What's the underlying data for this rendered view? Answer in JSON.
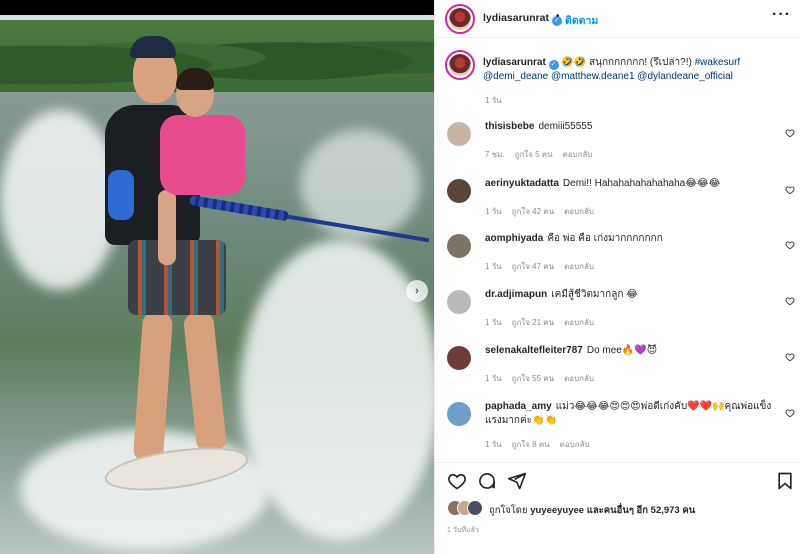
{
  "header": {
    "username": "lydiasarunrat",
    "follow_label": "ติดตาม",
    "dot": "•",
    "more_label": "···"
  },
  "caption": {
    "username": "lydiasarunrat",
    "text": "🤣🤣 สนุกกกกกกก! (รึเปล่า?!)",
    "hashtag": "#wakesurf",
    "mentions": "@demi_deane @matthew.deane1 @dylandeane_official",
    "time": "1 วัน"
  },
  "comments": [
    {
      "username": "thisisbebe",
      "text": "demiii55555",
      "time": "7 ชม.",
      "likes": "ถูกใจ 5 คน",
      "reply": "ตอบกลับ",
      "avatar_color": "#c9b3a5"
    },
    {
      "username": "aerinyuktadatta",
      "text": "Demi!! Hahahahahahahaha😂😂😂",
      "time": "1 วัน",
      "likes": "ถูกใจ 42 คน",
      "reply": "ตอบกลับ",
      "avatar_color": "#5a4636"
    },
    {
      "username": "aomphiyada",
      "text": "คือ พ่อ คือ เก่งมากกกกกกก",
      "time": "1 วัน",
      "likes": "ถูกใจ 47 คน",
      "reply": "ตอบกลับ",
      "avatar_color": "#7d7468"
    },
    {
      "username": "dr.adjimapun",
      "text": "เคมีสู้ชีวิตมากลูก 😂",
      "time": "1 วัน",
      "likes": "ถูกใจ 21 คน",
      "reply": "ตอบกลับ",
      "avatar_color": "#b9b9b9"
    },
    {
      "username": "selenakaltefleiter787",
      "text": "Do mee🔥💜😈",
      "time": "1 วัน",
      "likes": "ถูกใจ 55 คน",
      "reply": "ตอบกลับ",
      "avatar_color": "#6e3d3a"
    },
    {
      "username": "paphada_amy",
      "text": "แม่ว😂😂😂😍😍😍พ่อดีเก่งคับ❤️❤️🙌คุณพ่อแข็งแรงมากค่ะ👏👏",
      "time": "1 วัน",
      "likes": "ถูกใจ 8 คน",
      "reply": "ตอบกลับ",
      "avatar_color": "#6f9ec9"
    }
  ],
  "likes": {
    "prefix": "ถูกใจโดย",
    "user": "yuyeeyuyee",
    "middle": "และคนอื่นๆ อีก",
    "count": "52,973",
    "suffix": "คน"
  },
  "post_time": "1 วันที่แล้ว",
  "colors": {
    "accent": "#0095f6",
    "verified": "#3897f0",
    "muted": "#8e8e8e"
  }
}
